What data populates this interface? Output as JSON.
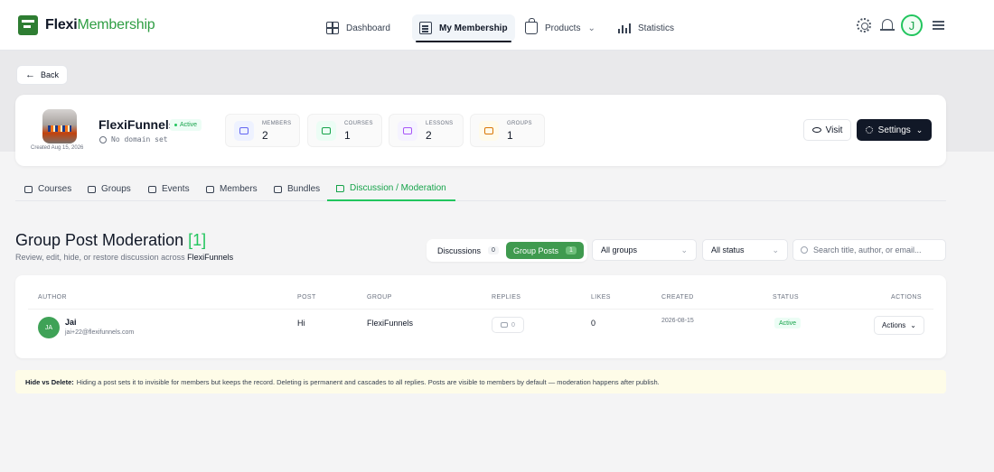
{
  "brand": {
    "part1": "Flexi",
    "part2": "Membership"
  },
  "nav": {
    "dashboard": "Dashboard",
    "my_membership": "My Membership",
    "products": "Products",
    "statistics": "Statistics",
    "avatar_initial": "J"
  },
  "back_label": "Back",
  "membership": {
    "title": "FlexiFunnels",
    "status": "Active",
    "domain": "No domain set",
    "created": "Created Aug 15, 2026"
  },
  "stats": [
    {
      "label": "MEMBERS",
      "value": "2",
      "color": "#6366f1",
      "bg": "#eef2ff"
    },
    {
      "label": "COURSES",
      "value": "1",
      "color": "#16a34a",
      "bg": "#ecfdf5"
    },
    {
      "label": "LESSONS",
      "value": "2",
      "color": "#a855f7",
      "bg": "#f5f3ff"
    },
    {
      "label": "GROUPS",
      "value": "1",
      "color": "#d97706",
      "bg": "#fffbeb"
    }
  ],
  "buttons": {
    "visit": "Visit",
    "settings": "Settings"
  },
  "tabs": [
    "Courses",
    "Groups",
    "Events",
    "Members",
    "Bundles",
    "Discussion / Moderation"
  ],
  "section": {
    "title": "Group Post Moderation",
    "count_label": "[1]",
    "subtitle": "Review, edit, hide, or restore discussion across",
    "subtitle_strong": "FlexiFunnels"
  },
  "segments": [
    {
      "label": "Discussions",
      "count": "0"
    },
    {
      "label": "Group Posts",
      "count": "1"
    }
  ],
  "filters": {
    "groups": "All groups",
    "status": "All status",
    "search_placeholder": "Search title, author, or email..."
  },
  "table": {
    "headers": [
      "AUTHOR",
      "POST",
      "GROUP",
      "REPLIES",
      "LIKES",
      "CREATED",
      "STATUS",
      "ACTIONS"
    ],
    "rows": [
      {
        "initials": "JA",
        "name": "Jai",
        "email": "jai+22@flexifunnels.com",
        "post": "Hi",
        "group": "FlexiFunnels",
        "replies": "0",
        "likes": "0",
        "created": "2026-08-15",
        "status": "Active",
        "action": "Actions"
      }
    ]
  },
  "note": {
    "strong": "Hide vs Delete:",
    "text": "Hiding a post sets it to invisible for members but keeps the record. Deleting is permanent and cascades to all replies. Posts are visible to members by default — moderation happens after publish."
  }
}
